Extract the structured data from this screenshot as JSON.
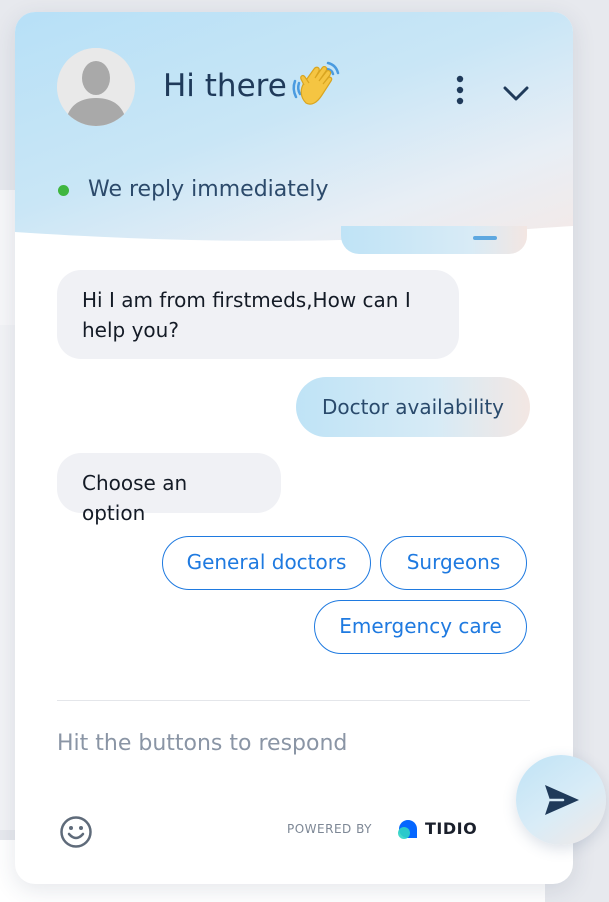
{
  "header": {
    "title": "Hi there",
    "status_text": "We reply immediately",
    "status_color": "#3fb63f",
    "menu_icon": "vertical-dots-icon",
    "collapse_icon": "chevron-down-icon",
    "avatar_icon": "person-silhouette-icon",
    "wave_icon": "waving-hand-icon"
  },
  "messages": [
    {
      "from": "bot",
      "text": "Hi I am from firstmeds,How can I help you?"
    },
    {
      "from": "user",
      "text": "Doctor availability"
    },
    {
      "from": "bot",
      "text": "Choose an option"
    }
  ],
  "options": [
    {
      "label": "General doctors"
    },
    {
      "label": "Surgeons"
    },
    {
      "label": "Emergency care"
    }
  ],
  "composer": {
    "placeholder": "Hit the buttons to respond",
    "emoji_icon": "smiley-face-icon",
    "send_icon": "paper-plane-icon"
  },
  "footer": {
    "powered_by": "POWERED BY",
    "brand": "TIDIO"
  },
  "colors": {
    "accent": "#1f7ae0",
    "text_dark": "#1f3a5a",
    "bubble_bot": "#f0f1f5"
  }
}
